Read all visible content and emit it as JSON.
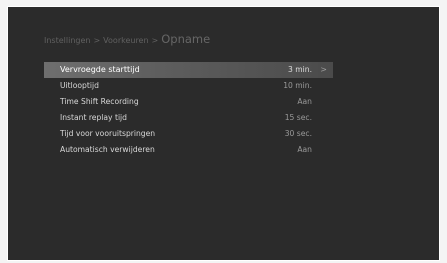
{
  "breadcrumb": {
    "level1": "Instellingen",
    "level2": "Voorkeuren",
    "current": "Opname",
    "separator": ">"
  },
  "menu": {
    "items": [
      {
        "label": "Vervroegde starttijd",
        "value": "3 min.",
        "selected": true
      },
      {
        "label": "Uitlooptijd",
        "value": "10 min."
      },
      {
        "label": "Time Shift Recording",
        "value": "Aan"
      },
      {
        "label": "Instant replay tijd",
        "value": "15 sec."
      },
      {
        "label": "Tijd voor vooruitspringen",
        "value": "30 sec."
      },
      {
        "label": "Automatisch verwijderen",
        "value": "Aan"
      }
    ],
    "chevron": ">"
  },
  "colors": {
    "background": "#2b2b2b",
    "highlight": "#6f6f6f",
    "text": "#d8d8d8",
    "value_text": "#9a9a9a"
  }
}
